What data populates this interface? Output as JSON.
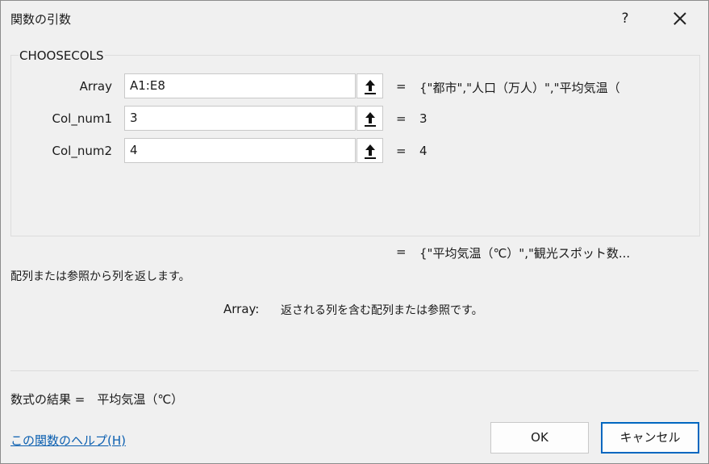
{
  "window": {
    "title": "関数の引数",
    "help_glyph": "?",
    "close_icon": "close-icon"
  },
  "function": {
    "name": "CHOOSECOLS",
    "description": "配列または参照から列を返します。"
  },
  "arguments": [
    {
      "label": "Array",
      "value": "A1:E8",
      "equals": "=",
      "evaluated": "{\"都市\",\"人口（万人）\",\"平均気温（"
    },
    {
      "label": "Col_num1",
      "value": "3",
      "equals": "=",
      "evaluated": "3"
    },
    {
      "label": "Col_num2",
      "value": "4",
      "equals": "=",
      "evaluated": "4"
    }
  ],
  "result": {
    "equals": "=",
    "value": "{\"平均気温（℃）\",\"観光スポット数..."
  },
  "argument_help": {
    "name": "Array:",
    "text": "返される列を含む配列または参照です。"
  },
  "formula_result": "数式の結果 =　平均気温（℃）",
  "help_link": "この関数のヘルプ(H)",
  "buttons": {
    "ok": "OK",
    "cancel": "キャンセル"
  },
  "colors": {
    "accent": "#0067c0",
    "link": "#0b5fb0",
    "background": "#f0f0f0"
  }
}
